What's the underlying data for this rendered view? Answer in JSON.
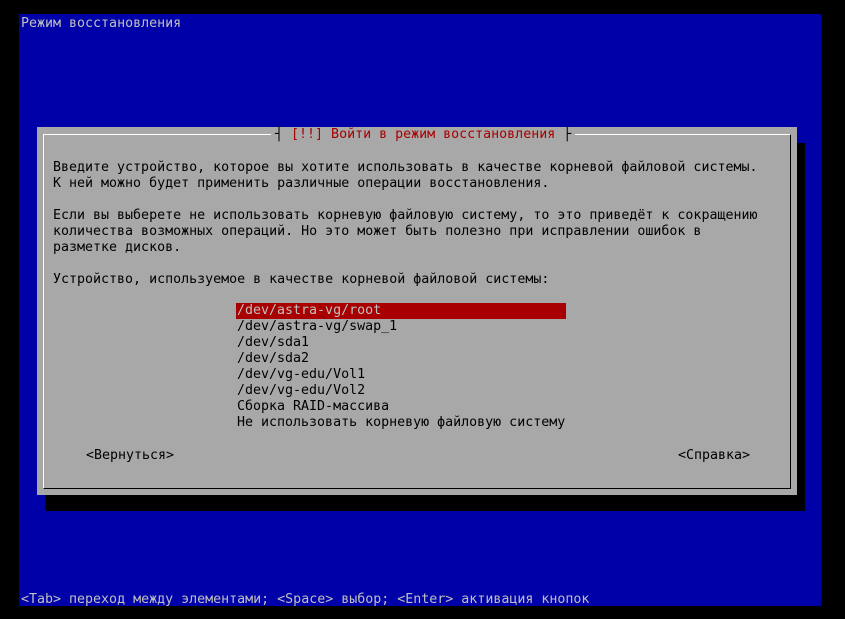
{
  "screen_title": "Режим восстановления",
  "dialog": {
    "title": "[!!] Войти в режим восстановления",
    "paragraph1_line1": "Введите устройство, которое вы хотите использовать в качестве корневой файловой системы.",
    "paragraph1_line2": "К ней можно будет применить различные операции восстановления.",
    "paragraph2_line1": "Если вы выберете не использовать корневую файловую систему, то это приведёт к сокращению",
    "paragraph2_line2": "количества возможных операций. Но это может быть полезно при исправлении ошибок в",
    "paragraph2_line3": "разметке дисков.",
    "prompt": "Устройство, используемое в качестве корневой файловой системы:",
    "options": [
      {
        "label": "/dev/astra-vg/root",
        "selected": true
      },
      {
        "label": "/dev/astra-vg/swap_1",
        "selected": false
      },
      {
        "label": "/dev/sda1",
        "selected": false
      },
      {
        "label": "/dev/sda2",
        "selected": false
      },
      {
        "label": "/dev/vg-edu/Vol1",
        "selected": false
      },
      {
        "label": "/dev/vg-edu/Vol2",
        "selected": false
      },
      {
        "label": "Сборка RAID-массива",
        "selected": false
      },
      {
        "label": "Не использовать корневую файловую систему",
        "selected": false
      }
    ],
    "back_button": "<Вернуться>",
    "help_button": "<Справка>"
  },
  "help_line": "<Tab> переход между элементами; <Space> выбор; <Enter> активация кнопок",
  "colors": {
    "background": "#0000a8",
    "dialog": "#a8a8a8",
    "accent": "#a80000"
  }
}
